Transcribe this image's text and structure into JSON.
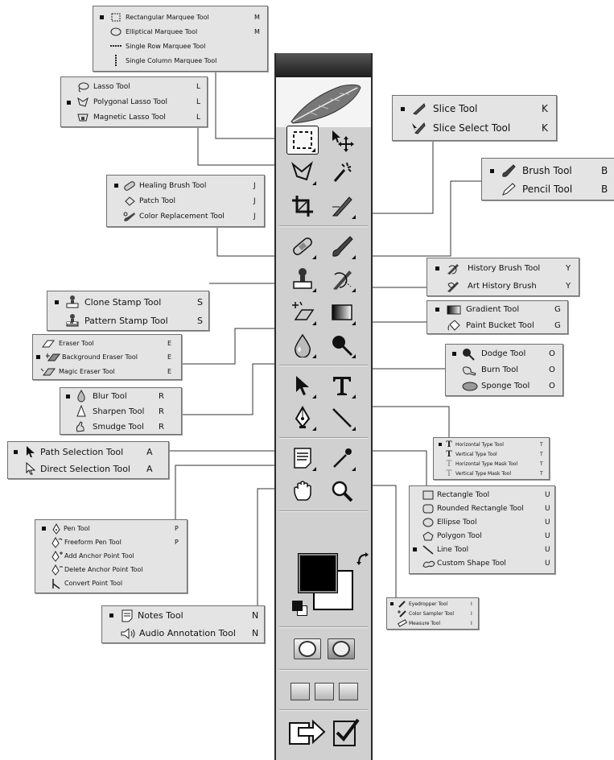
{
  "flyouts": {
    "marquee": {
      "items": [
        {
          "label": "Rectangular Marquee Tool",
          "key": "M",
          "selected": true
        },
        {
          "label": "Elliptical Marquee Tool",
          "key": "M"
        },
        {
          "label": "Single Row Marquee Tool",
          "key": ""
        },
        {
          "label": "Single Column Marquee Tool",
          "key": ""
        }
      ]
    },
    "lasso": {
      "items": [
        {
          "label": "Lasso Tool",
          "key": "L"
        },
        {
          "label": "Polygonal Lasso Tool",
          "key": "L",
          "selected": true
        },
        {
          "label": "Magnetic Lasso Tool",
          "key": "L"
        }
      ]
    },
    "slice": {
      "items": [
        {
          "label": "Slice Tool",
          "key": "K",
          "selected": true
        },
        {
          "label": "Slice Select Tool",
          "key": "K"
        }
      ]
    },
    "brush": {
      "items": [
        {
          "label": "Brush Tool",
          "key": "B",
          "selected": true
        },
        {
          "label": "Pencil Tool",
          "key": "B"
        }
      ]
    },
    "healing": {
      "items": [
        {
          "label": "Healing Brush Tool",
          "key": "J",
          "selected": true
        },
        {
          "label": "Patch Tool",
          "key": "J"
        },
        {
          "label": "Color Replacement Tool",
          "key": "J"
        }
      ]
    },
    "history": {
      "items": [
        {
          "label": "History Brush Tool",
          "key": "Y",
          "selected": true
        },
        {
          "label": "Art History Brush",
          "key": "Y"
        }
      ]
    },
    "stamp": {
      "items": [
        {
          "label": "Clone Stamp Tool",
          "key": "S",
          "selected": true
        },
        {
          "label": "Pattern Stamp Tool",
          "key": "S"
        }
      ]
    },
    "gradient": {
      "items": [
        {
          "label": "Gradient Tool",
          "key": "G",
          "selected": true
        },
        {
          "label": "Paint Bucket Tool",
          "key": "G"
        }
      ]
    },
    "eraser": {
      "items": [
        {
          "label": "Eraser Tool",
          "key": "E"
        },
        {
          "label": "Background Eraser Tool",
          "key": "E",
          "selected": true
        },
        {
          "label": "Magic Eraser Tool",
          "key": "E"
        }
      ]
    },
    "dodge": {
      "items": [
        {
          "label": "Dodge Tool",
          "key": "O",
          "selected": true
        },
        {
          "label": "Burn Tool",
          "key": "O"
        },
        {
          "label": "Sponge Tool",
          "key": "O"
        }
      ]
    },
    "blur": {
      "items": [
        {
          "label": "Blur Tool",
          "key": "R",
          "selected": true
        },
        {
          "label": "Sharpen Tool",
          "key": "R"
        },
        {
          "label": "Smudge Tool",
          "key": "R"
        }
      ]
    },
    "path": {
      "items": [
        {
          "label": "Path Selection Tool",
          "key": "A",
          "selected": true
        },
        {
          "label": "Direct Selection Tool",
          "key": "A"
        }
      ]
    },
    "type": {
      "items": [
        {
          "label": "Horizontal Type Tool",
          "key": "T",
          "selected": true
        },
        {
          "label": "Vertical Type Tool",
          "key": "T"
        },
        {
          "label": "Horizontal Type Mask Tool",
          "key": "T"
        },
        {
          "label": "Vertical Type Mask Tool",
          "key": "T"
        }
      ]
    },
    "shape": {
      "items": [
        {
          "label": "Rectangle Tool",
          "key": "U"
        },
        {
          "label": "Rounded Rectangle Tool",
          "key": "U"
        },
        {
          "label": "Ellipse Tool",
          "key": "U"
        },
        {
          "label": "Polygon Tool",
          "key": "U"
        },
        {
          "label": "Line Tool",
          "key": "U",
          "selected": true
        },
        {
          "label": "Custom Shape Tool",
          "key": "U"
        }
      ]
    },
    "pen": {
      "items": [
        {
          "label": "Pen Tool",
          "key": "P",
          "selected": true
        },
        {
          "label": "Freeform Pen Tool",
          "key": "P"
        },
        {
          "label": "Add Anchor Point Tool",
          "key": ""
        },
        {
          "label": "Delete Anchor Point Tool",
          "key": ""
        },
        {
          "label": "Convert Point Tool",
          "key": ""
        }
      ]
    },
    "notes": {
      "items": [
        {
          "label": "Notes Tool",
          "key": "N",
          "selected": true
        },
        {
          "label": "Audio Annotation Tool",
          "key": "N"
        }
      ]
    },
    "eyedropper": {
      "items": [
        {
          "label": "Eyedropper Tool",
          "key": "I",
          "selected": true
        },
        {
          "label": "Color Sampler Tool",
          "key": "I"
        },
        {
          "label": "Measure Tool",
          "key": "I"
        }
      ]
    }
  },
  "toolbox": {
    "header_color": "#1d1d1d",
    "panel_color": "#d0d0d0",
    "foreground_color": "#000000",
    "background_color": "#ffffff",
    "tools": [
      "rect-marquee-icon",
      "move-icon",
      "lasso-icon",
      "magic-wand-icon",
      "crop-icon",
      "slice-icon",
      "healing-brush-icon",
      "brush-icon",
      "clone-stamp-icon",
      "history-brush-icon",
      "eraser-icon",
      "gradient-icon",
      "blur-icon",
      "dodge-icon",
      "path-selection-icon",
      "type-icon",
      "pen-icon",
      "line-icon",
      "notes-icon",
      "eyedropper-icon",
      "hand-icon",
      "zoom-icon"
    ]
  }
}
